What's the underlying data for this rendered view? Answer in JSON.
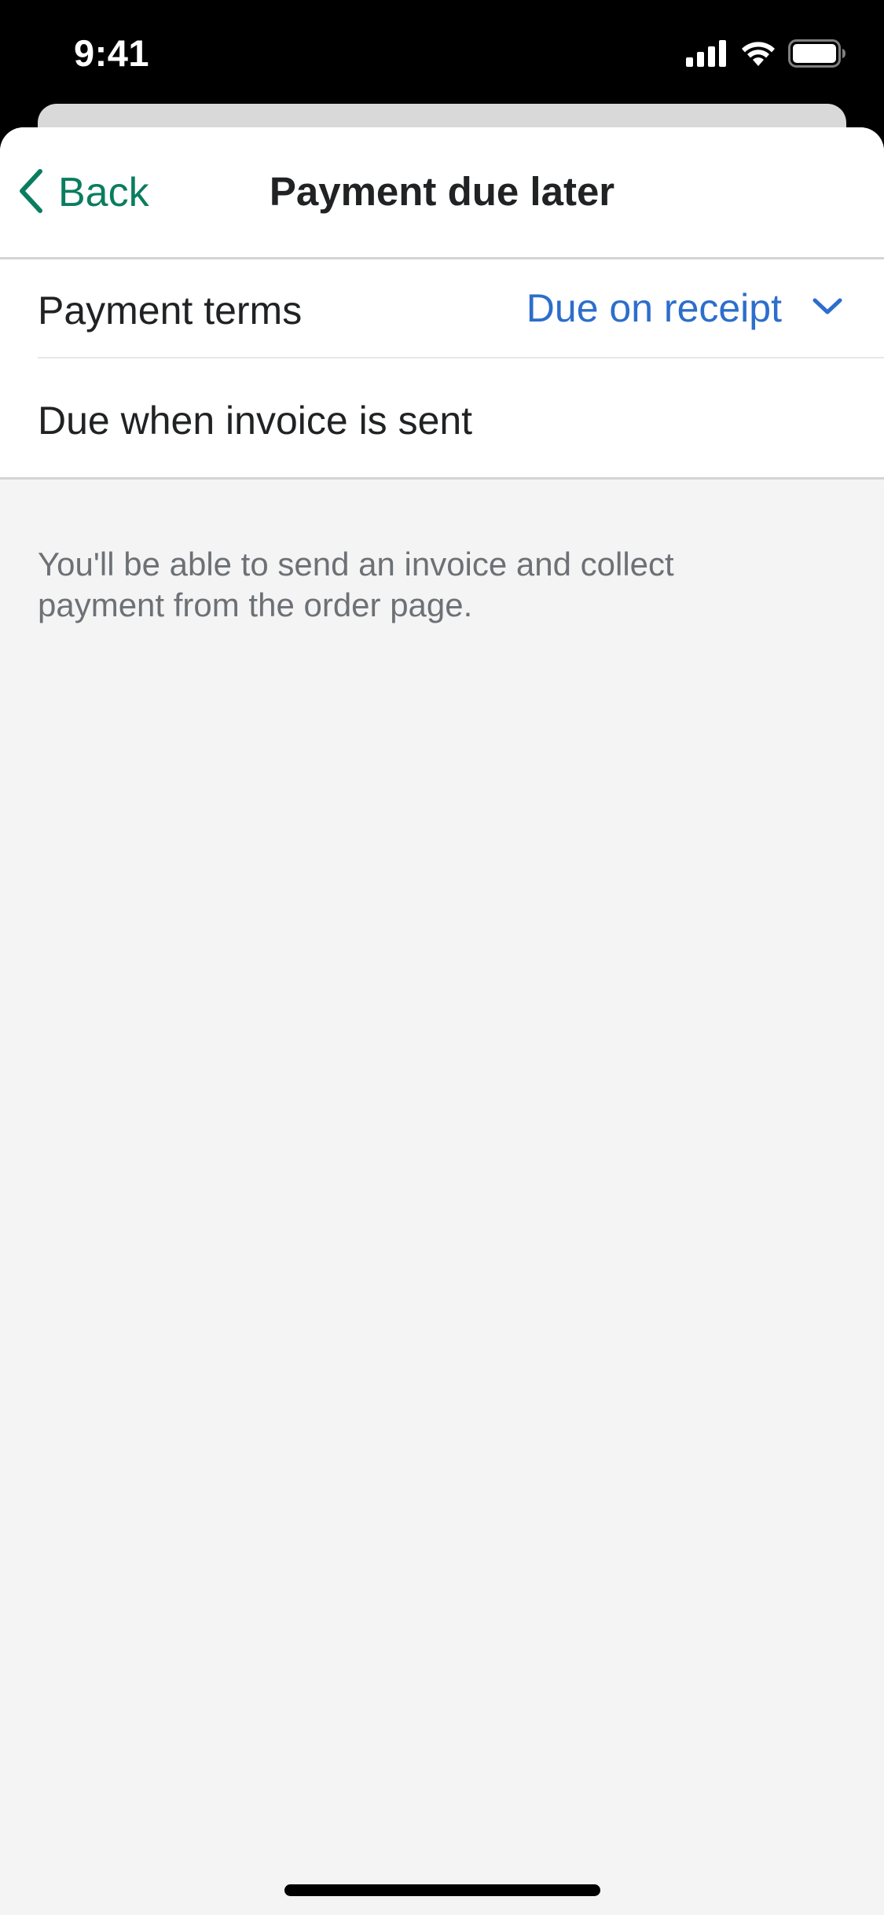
{
  "status_bar": {
    "time": "9:41",
    "icons": [
      "signal-icon",
      "wifi-icon",
      "battery-icon"
    ]
  },
  "nav": {
    "back_label": "Back",
    "title": "Payment due later"
  },
  "payment_terms": {
    "label": "Payment terms",
    "selected_value": "Due on receipt",
    "description": "Due when invoice is sent"
  },
  "help_text": "You'll be able to send an invoice and collect payment from the order page.",
  "colors": {
    "accent_green": "#0a7d5f",
    "link_blue": "#2c6ecb",
    "text_primary": "#202223",
    "text_subdued": "#6d7175",
    "background": "#f4f4f4"
  }
}
